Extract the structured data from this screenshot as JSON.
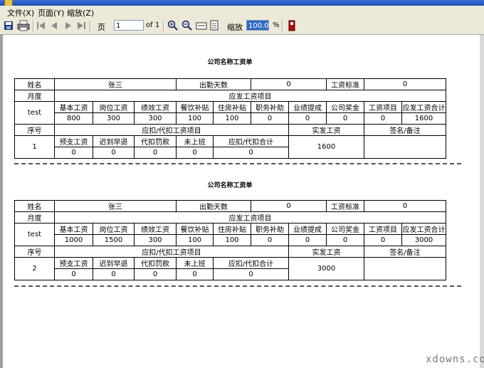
{
  "window": {
    "title": ""
  },
  "menu": {
    "items": [
      "文件(X)",
      "页面(Y)",
      "缩放(Z)"
    ]
  },
  "toolbar": {
    "page_label": "页",
    "page_value": "1",
    "of_label": "of 1",
    "zoom_label": "缩放",
    "zoom_value": "100.0",
    "percent_label": "%"
  },
  "labels": {
    "title": "公司名称工资单",
    "name": "姓名",
    "attendance": "出勤天数",
    "salary_standard": "工资标准",
    "month": "月度",
    "payable_items": "应发工资项目",
    "payable_headers": [
      "基本工资",
      "岗位工资",
      "绩效工资",
      "餐饮补贴",
      "住房补贴",
      "职务补助",
      "业绩提成",
      "公司奖金",
      "工资项目",
      "应发工资合计"
    ],
    "seq": "序号",
    "deduct_items": "应扣/代扣工资项目",
    "actual_pay": "实发工资",
    "signature": "签名/备注",
    "deduct_headers": [
      "预支工资",
      "迟到早退",
      "代扣罚款",
      "未上班",
      "应扣/代扣合计"
    ]
  },
  "slips": [
    {
      "name": "张三",
      "attendance": "0",
      "standard": "0",
      "month": "test",
      "payable": [
        "800",
        "300",
        "300",
        "100",
        "100",
        "0",
        "0",
        "0",
        "0",
        "1600"
      ],
      "seq": "1",
      "deduct": [
        "0",
        "0",
        "0",
        "0",
        "0"
      ],
      "actual": "1600",
      "signature": ""
    },
    {
      "name": "张三",
      "attendance": "0",
      "standard": "0",
      "month": "test",
      "payable": [
        "1000",
        "1500",
        "300",
        "100",
        "100",
        "0",
        "0",
        "0",
        "0",
        "3000"
      ],
      "seq": "2",
      "deduct": [
        "0",
        "0",
        "0",
        "0",
        "0"
      ],
      "actual": "3000",
      "signature": ""
    }
  ],
  "watermark": "xdowns.com"
}
